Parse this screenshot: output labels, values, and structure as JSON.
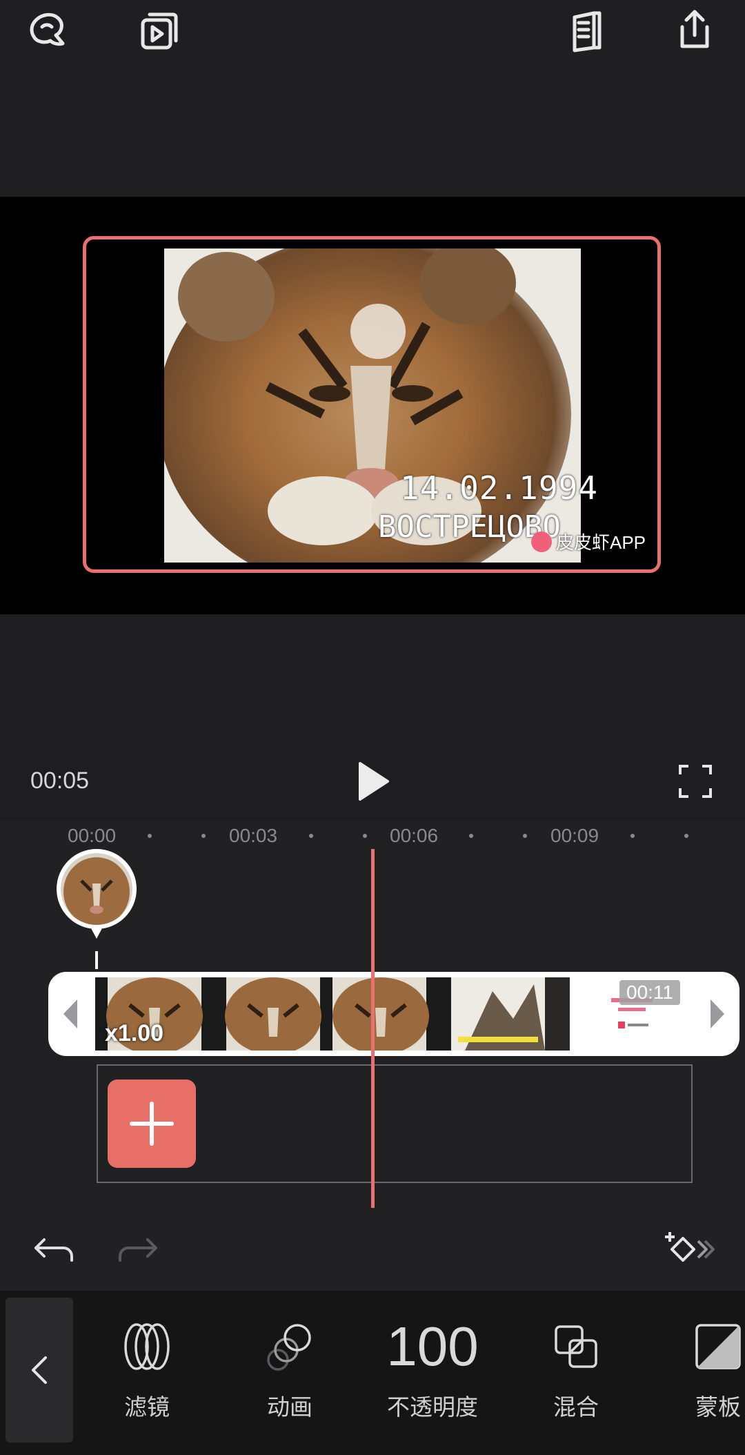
{
  "header": {
    "icons": [
      "tutorial-icon",
      "preview-play-icon",
      "book-icon",
      "share-icon"
    ]
  },
  "preview": {
    "overlay_date": "14.02.1994",
    "overlay_place": "ВОСТРЕЦОВО",
    "watermark": "皮皮虾APP"
  },
  "player": {
    "current_time": "00:05"
  },
  "timeline": {
    "ruler": [
      "00:00",
      "00:03",
      "00:06",
      "00:09"
    ],
    "clip_speed": "x1.00",
    "clip_duration": "00:11"
  },
  "toolbar": {
    "tools": [
      {
        "label": "滤镜",
        "icon": "filter-icon"
      },
      {
        "label": "动画",
        "icon": "animation-icon"
      },
      {
        "label": "不透明度",
        "value": "100"
      },
      {
        "label": "混合",
        "icon": "blend-icon"
      },
      {
        "label": "蒙板",
        "icon": "mask-icon"
      }
    ]
  },
  "colors": {
    "accent": "#e8716d",
    "background": "#1e1e20",
    "toolbar": "#151516"
  }
}
